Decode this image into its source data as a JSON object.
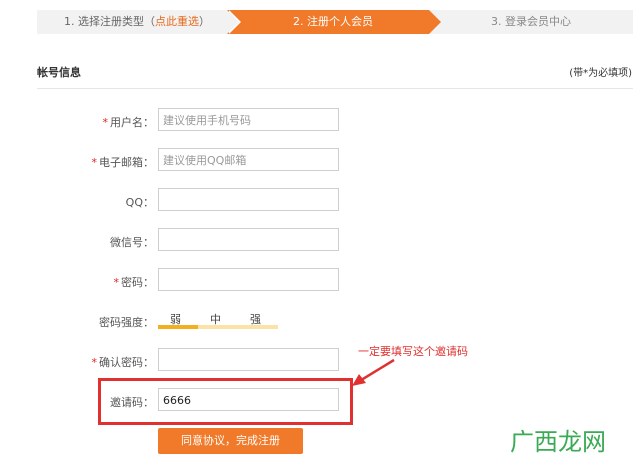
{
  "steps": {
    "step1_prefix": "1. 选择注册类型（",
    "step1_link": "点此重选",
    "step1_suffix": "）",
    "step2": "2. 注册个人会员",
    "step3": "3. 登录会员中心"
  },
  "section": {
    "title": "帐号信息",
    "required_note": "(带*为必填项)"
  },
  "form": {
    "username_label": "用户名：",
    "username_placeholder": "建议使用手机号码",
    "email_label": "电子邮箱：",
    "email_placeholder": "建议使用QQ邮箱",
    "qq_label": "QQ：",
    "wechat_label": "微信号：",
    "password_label": "密码：",
    "strength_label": "密码强度：",
    "strength_weak": "弱",
    "strength_medium": "中",
    "strength_strong": "强",
    "confirm_label": "确认密码：",
    "invite_label": "邀请码：",
    "invite_value": "6666",
    "star": "*"
  },
  "annotation": {
    "callout": "一定要填写这个邀请码"
  },
  "submit_label": "同意协议，完成注册",
  "watermark": "广西龙网",
  "colors": {
    "accent": "#f07a2a",
    "annotation": "#e03030",
    "strength_weak": "#f2b01e"
  }
}
